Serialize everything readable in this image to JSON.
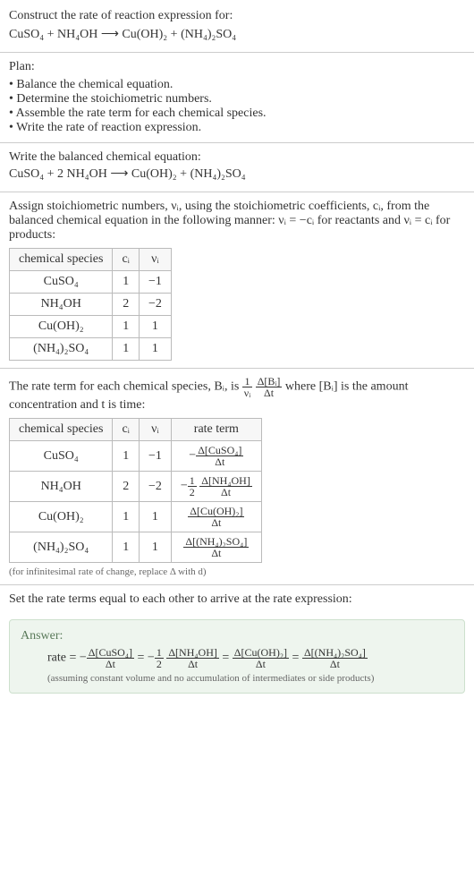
{
  "prompt": {
    "line1": "Construct the rate of reaction expression for:",
    "equation": "CuSO₄ + NH₄OH ⟶ Cu(OH)₂ + (NH₄)₂SO₄"
  },
  "plan": {
    "heading": "Plan:",
    "items": [
      "Balance the chemical equation.",
      "Determine the stoichiometric numbers.",
      "Assemble the rate term for each chemical species.",
      "Write the rate of reaction expression."
    ]
  },
  "balanced": {
    "heading": "Write the balanced chemical equation:",
    "equation": "CuSO₄ + 2 NH₄OH ⟶ Cu(OH)₂ + (NH₄)₂SO₄"
  },
  "stoich": {
    "text": "Assign stoichiometric numbers, νᵢ, using the stoichiometric coefficients, cᵢ, from the balanced chemical equation in the following manner: νᵢ = −cᵢ for reactants and νᵢ = cᵢ for products:",
    "headers": [
      "chemical species",
      "cᵢ",
      "νᵢ"
    ],
    "rows": [
      [
        "CuSO₄",
        "1",
        "−1"
      ],
      [
        "NH₄OH",
        "2",
        "−2"
      ],
      [
        "Cu(OH)₂",
        "1",
        "1"
      ],
      [
        "(NH₄)₂SO₄",
        "1",
        "1"
      ]
    ]
  },
  "rateterm": {
    "text_before": "The rate term for each chemical species, Bᵢ, is ",
    "text_after": " where [Bᵢ] is the amount concentration and t is time:",
    "headers": [
      "chemical species",
      "cᵢ",
      "νᵢ",
      "rate term"
    ],
    "rows": [
      {
        "species": "CuSO₄",
        "c": "1",
        "v": "−1",
        "term_prefix": "−",
        "term_num": "Δ[CuSO₄]",
        "term_den": "Δt",
        "coef_num": "",
        "coef_den": ""
      },
      {
        "species": "NH₄OH",
        "c": "2",
        "v": "−2",
        "term_prefix": "−",
        "term_num": "Δ[NH₄OH]",
        "term_den": "Δt",
        "coef_num": "1",
        "coef_den": "2"
      },
      {
        "species": "Cu(OH)₂",
        "c": "1",
        "v": "1",
        "term_prefix": "",
        "term_num": "Δ[Cu(OH)₂]",
        "term_den": "Δt",
        "coef_num": "",
        "coef_den": ""
      },
      {
        "species": "(NH₄)₂SO₄",
        "c": "1",
        "v": "1",
        "term_prefix": "",
        "term_num": "Δ[(NH₄)₂SO₄]",
        "term_den": "Δt",
        "coef_num": "",
        "coef_den": ""
      }
    ],
    "note": "(for infinitesimal rate of change, replace Δ with d)"
  },
  "final": {
    "heading": "Set the rate terms equal to each other to arrive at the rate expression:"
  },
  "answer": {
    "label": "Answer:",
    "rate_label": "rate = ",
    "note": "(assuming constant volume and no accumulation of intermediates or side products)"
  },
  "chart_data": {
    "type": "table",
    "tables": [
      {
        "title": "Stoichiometric numbers",
        "headers": [
          "chemical species",
          "c_i",
          "ν_i"
        ],
        "rows": [
          [
            "CuSO4",
            1,
            -1
          ],
          [
            "NH4OH",
            2,
            -2
          ],
          [
            "Cu(OH)2",
            1,
            1
          ],
          [
            "(NH4)2SO4",
            1,
            1
          ]
        ]
      },
      {
        "title": "Rate terms",
        "headers": [
          "chemical species",
          "c_i",
          "ν_i",
          "rate term"
        ],
        "rows": [
          [
            "CuSO4",
            1,
            -1,
            "-Δ[CuSO4]/Δt"
          ],
          [
            "NH4OH",
            2,
            -2,
            "-(1/2)Δ[NH4OH]/Δt"
          ],
          [
            "Cu(OH)2",
            1,
            1,
            "Δ[Cu(OH)2]/Δt"
          ],
          [
            "(NH4)2SO4",
            1,
            1,
            "Δ[(NH4)2SO4]/Δt"
          ]
        ]
      }
    ],
    "rate_expression": "rate = -Δ[CuSO4]/Δt = -(1/2)Δ[NH4OH]/Δt = Δ[Cu(OH)2]/Δt = Δ[(NH4)2SO4]/Δt"
  }
}
